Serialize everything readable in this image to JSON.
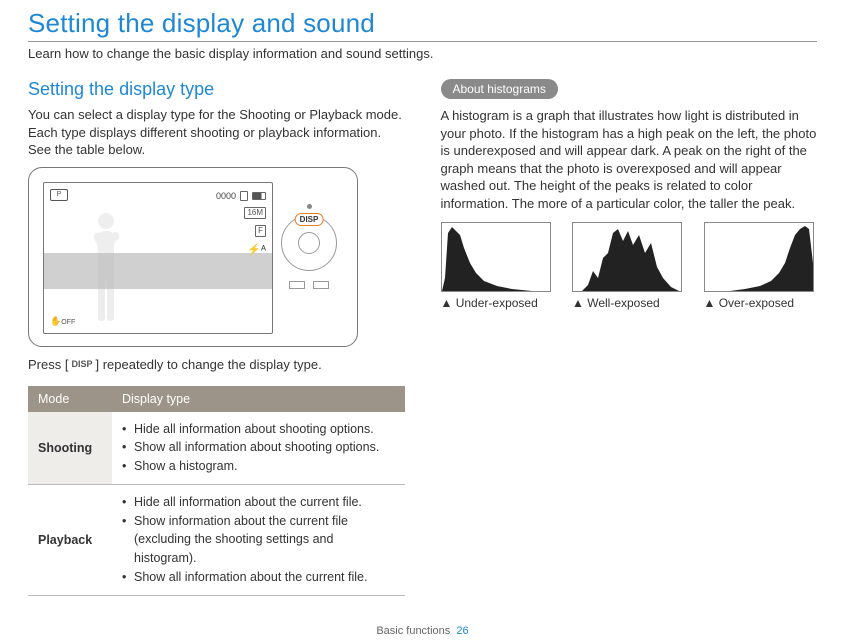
{
  "title": "Setting the display and sound",
  "subtitle": "Learn how to change the basic display information and sound settings.",
  "left": {
    "section_title": "Setting the display type",
    "intro": "You can select a display type for the Shooting or Playback mode. Each type displays different shooting or playback information. See the table below.",
    "disp_badge": "DISP",
    "press_prefix": "Press [",
    "press_disp": "DISP",
    "press_suffix": "] repeatedly to change the display type.",
    "screen_topleft": "P",
    "screen_count": "0000",
    "screen_off": "OFF",
    "table": {
      "head_mode": "Mode",
      "head_type": "Display type",
      "rows": [
        {
          "mode": "Shooting",
          "items": [
            "Hide all information about shooting options.",
            "Show all information about shooting options.",
            "Show a histogram."
          ]
        },
        {
          "mode": "Playback",
          "items": [
            "Hide all information about the current file.",
            "Show information about the current file (excluding the shooting settings and histogram).",
            "Show all information about the current file."
          ]
        }
      ]
    }
  },
  "right": {
    "pill": "About histograms",
    "para": "A histogram is a graph that illustrates how light is distributed in your photo. If the histogram has a high peak on the left, the photo is underexposed and will appear dark. A peak on the right of the graph means that the photo is overexposed and will appear washed out. The height of the peaks is related to color information. The more of a particular color, the taller the peak.",
    "captions": {
      "under": "▲ Under-exposed",
      "well": "▲ Well-exposed",
      "over": "▲ Over-exposed"
    }
  },
  "footer": {
    "section": "Basic functions",
    "page": "26"
  }
}
